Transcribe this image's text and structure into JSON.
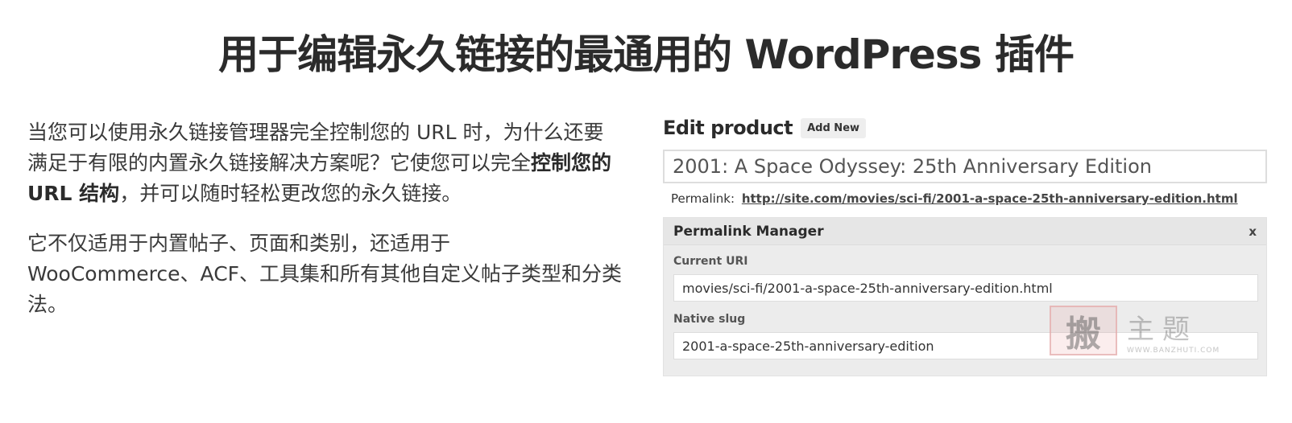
{
  "page": {
    "title": "用于编辑永久链接的最通用的 WordPress 插件"
  },
  "left": {
    "para1_pre": "当您可以使用永久链接管理器完全控制您的 URL 时，为什么还要满足于有限的内置永久链接解决方案呢？它使您可以完全",
    "para1_bold": "控制您的 URL 结构",
    "para1_post": "，并可以随时轻松更改您的永久链接。",
    "para2": "它不仅适用于内置帖子、页面和类别，还适用于 WooCommerce、ACF、工具集和所有其他自定义帖子类型和分类法。"
  },
  "editor": {
    "heading": "Edit product",
    "add_new_label": "Add New",
    "title_value": "2001: A Space Odyssey: 25th Anniversary Edition",
    "permalink_label": "Permalink:",
    "permalink_url": "http://site.com/movies/sci-fi/2001-a-space-25th-anniversary-edition.html"
  },
  "permalink_manager": {
    "title": "Permalink Manager",
    "close_label": "x",
    "current_uri_label": "Current URI",
    "current_uri_value": "movies/sci-fi/2001-a-space-25th-anniversary-edition.html",
    "native_slug_label": "Native slug",
    "native_slug_value": "2001-a-space-25th-anniversary-edition"
  },
  "watermark": {
    "seal_char": "搬",
    "text": "主题",
    "url": "WWW.BANZHUTI.COM"
  }
}
